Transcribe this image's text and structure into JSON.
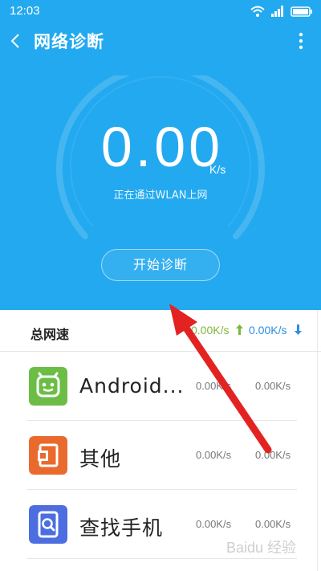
{
  "status_bar": {
    "time": "12:03",
    "icons": [
      "wifi-icon",
      "signal-icon",
      "battery-icon"
    ]
  },
  "header": {
    "title": "网络诊断",
    "back_icon": "chevron-left-icon",
    "more_icon": "more-vertical-icon"
  },
  "speed_panel": {
    "value": "0.00",
    "unit": "K/s",
    "status": "正在通过WLAN上网",
    "start_button": "开始诊断"
  },
  "summary": {
    "label": "总网速",
    "upload": "0.00K/s",
    "download": "0.00K/s"
  },
  "apps": [
    {
      "name": "Android...",
      "upload": "0.00K/s",
      "download": "0.00K/s",
      "icon": "android-icon"
    },
    {
      "name": "其他",
      "upload": "0.00K/s",
      "download": "0.00K/s",
      "icon": "other-apps-icon"
    },
    {
      "name": "查找手机",
      "upload": "0.00K/s",
      "download": "0.00K/s",
      "icon": "find-phone-icon"
    }
  ],
  "colors": {
    "primary": "#23a9ef",
    "upload": "#7db83a",
    "download": "#2d8ee0",
    "annotation": "#e32322"
  },
  "watermark": "Baidu 经验"
}
